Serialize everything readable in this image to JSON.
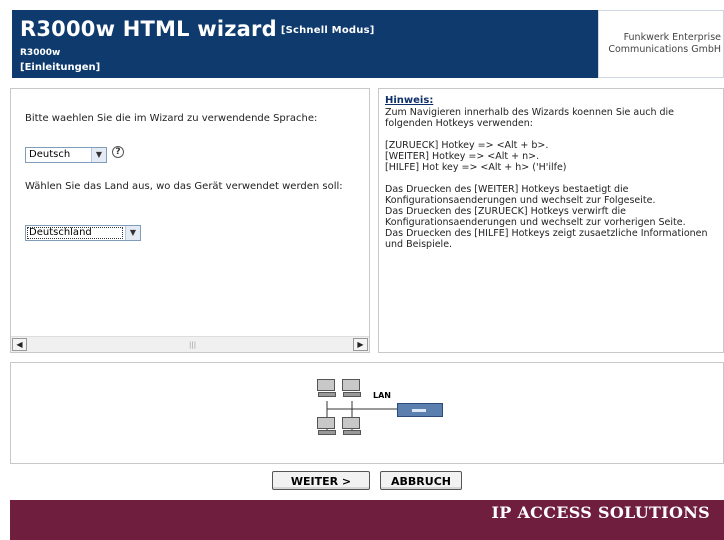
{
  "header": {
    "title": "R3000w HTML wizard",
    "mode": "[Schnell Modus]",
    "model": "R3000w",
    "section": "[Einleitungen]",
    "company_line1": "Funkwerk Enterprise",
    "company_line2": "Communications GmbH"
  },
  "language": {
    "prompt": "Bitte waehlen Sie die im Wizard zu verwendende Sprache:",
    "selected": "Deutsch"
  },
  "country": {
    "prompt": "Wählen Sie das Land aus, wo das Gerät verwendet werden soll:",
    "selected": "Deutschland"
  },
  "hint": {
    "title": "Hinweis:",
    "intro": "Zum Navigieren innerhalb des Wizards koennen Sie auch die folgenden Hotkeys verwenden:",
    "hotkey_back": "[ZURUECK] Hotkey => <Alt + b>.",
    "hotkey_next": "[WEITER] Hotkey => <Alt + n>.",
    "hotkey_help": "[HILFE] Hot key => <Alt + h> ('H'ilfe)",
    "desc_next": "Das Druecken des [WEITER] Hotkeys bestaetigt die Konfigurationsaenderungen und wechselt zur Folgeseite.",
    "desc_back": "Das Druecken des [ZURUECK] Hotkeys verwirft die Konfigurationsaenderungen und wechselt zur vorherigen Seite.",
    "desc_help": "Das Druecken des [HILFE] Hotkeys zeigt zusaetzliche Informationen und Beispiele."
  },
  "diagram": {
    "lan_label": "LAN"
  },
  "buttons": {
    "next": "WEITER >",
    "cancel": "ABBRUCH"
  },
  "footer": {
    "text": "IP ACCESS SOLUTIONS"
  },
  "colors": {
    "header_bg": "#0e3a6e",
    "footer_bg": "#6f1f3d"
  },
  "icons": {
    "help": "help-icon",
    "dropdown": "chevron-down-icon",
    "scroll_left": "arrow-left-icon",
    "scroll_right": "arrow-right-icon"
  }
}
